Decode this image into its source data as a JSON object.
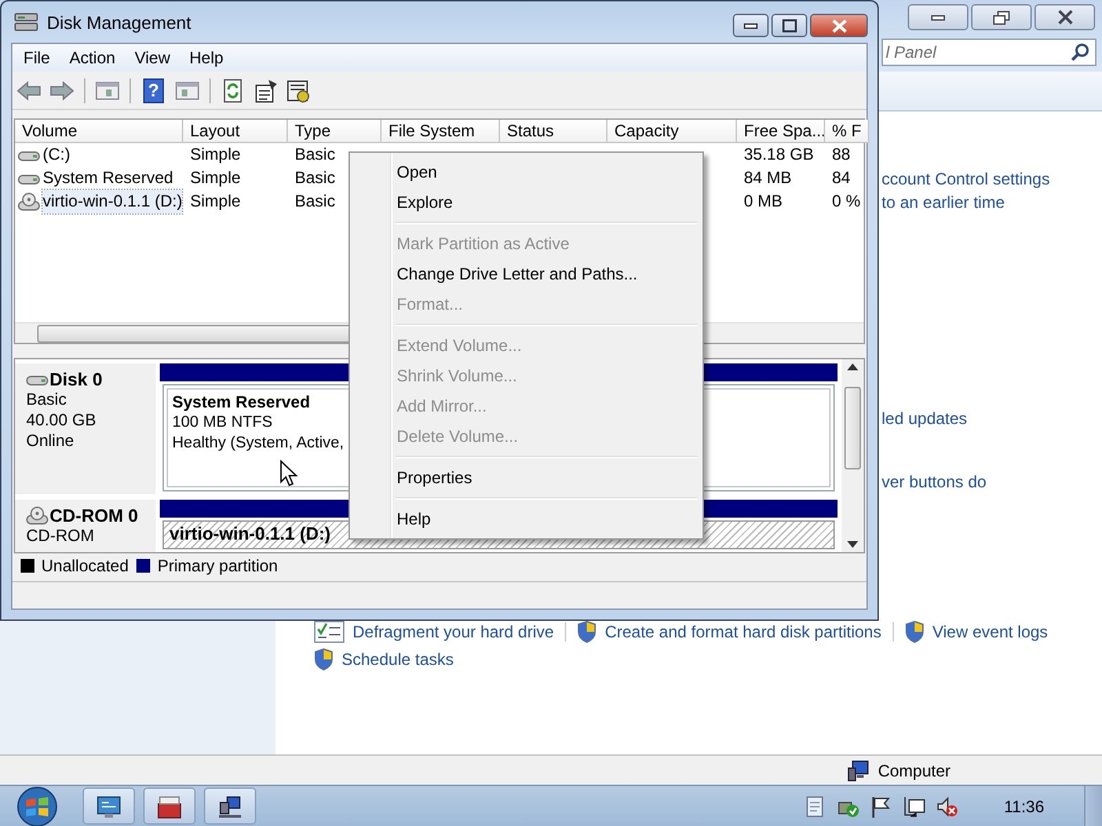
{
  "background_window": {
    "search": {
      "placeholder": "l Panel"
    },
    "links": [
      {
        "text": "ccount Control settings"
      },
      {
        "text": "to an earlier time"
      },
      {
        "text": "led updates"
      },
      {
        "text": "ver buttons do"
      }
    ],
    "task_links": [
      {
        "text": "Defragment your hard drive"
      },
      {
        "text": "Create and format hard disk partitions"
      },
      {
        "text": "View event logs"
      },
      {
        "text": "Schedule tasks"
      }
    ],
    "status_bar": {
      "location": "Computer"
    }
  },
  "window": {
    "title": "Disk Management",
    "menu": [
      "File",
      "Action",
      "View",
      "Help"
    ],
    "toolbar": {
      "help_glyph": "?"
    },
    "volume_table": {
      "columns": [
        "Volume",
        "Layout",
        "Type",
        "File System",
        "Status",
        "Capacity",
        "Free Spa...",
        "% F"
      ],
      "rows": [
        {
          "kind": "disk",
          "volume": "(C:)",
          "layout": "Simple",
          "type": "Basic",
          "free_space": "35.18 GB",
          "percent_free": "88",
          "selected": false
        },
        {
          "kind": "disk",
          "volume": "System Reserved",
          "layout": "Simple",
          "type": "Basic",
          "free_space": "84 MB",
          "percent_free": "84",
          "selected": false
        },
        {
          "kind": "cdrom",
          "volume": "virtio-win-0.1.1 (D:)",
          "layout": "Simple",
          "type": "Basic",
          "free_space": "0 MB",
          "percent_free": "0 %",
          "selected": true
        }
      ]
    },
    "disks": [
      {
        "kind": "disk",
        "name": "Disk 0",
        "type": "Basic",
        "size": "40.00 GB",
        "status": "Online",
        "partitions": [
          {
            "kind": "primary",
            "name": "System Reserved",
            "size": "100 MB NTFS",
            "status": "Healthy (System, Active,"
          },
          {
            "kind": "primary"
          }
        ]
      },
      {
        "kind": "cdrom",
        "name": "CD-ROM 0",
        "type": "CD-ROM",
        "partitions": [
          {
            "kind": "cd",
            "name": "virtio-win-0.1.1  (D:)"
          }
        ]
      }
    ],
    "legend": [
      {
        "label": "Unallocated",
        "color": "#000000"
      },
      {
        "label": "Primary partition",
        "color": "#00007f"
      }
    ]
  },
  "context_menu": {
    "items": [
      {
        "kind": "item",
        "label": "Open",
        "disabled": false
      },
      {
        "kind": "item",
        "label": "Explore",
        "disabled": false
      },
      {
        "kind": "separator"
      },
      {
        "kind": "item",
        "label": "Mark Partition as Active",
        "disabled": true
      },
      {
        "kind": "item",
        "label": "Change Drive Letter and Paths...",
        "disabled": false
      },
      {
        "kind": "item",
        "label": "Format...",
        "disabled": true
      },
      {
        "kind": "separator"
      },
      {
        "kind": "item",
        "label": "Extend Volume...",
        "disabled": true
      },
      {
        "kind": "item",
        "label": "Shrink Volume...",
        "disabled": true
      },
      {
        "kind": "item",
        "label": "Add Mirror...",
        "disabled": true
      },
      {
        "kind": "item",
        "label": "Delete Volume...",
        "disabled": true
      },
      {
        "kind": "separator"
      },
      {
        "kind": "item",
        "label": "Properties",
        "disabled": false
      },
      {
        "kind": "separator"
      },
      {
        "kind": "item",
        "label": "Help",
        "disabled": false
      }
    ]
  },
  "taskbar": {
    "clock": "11:36"
  }
}
